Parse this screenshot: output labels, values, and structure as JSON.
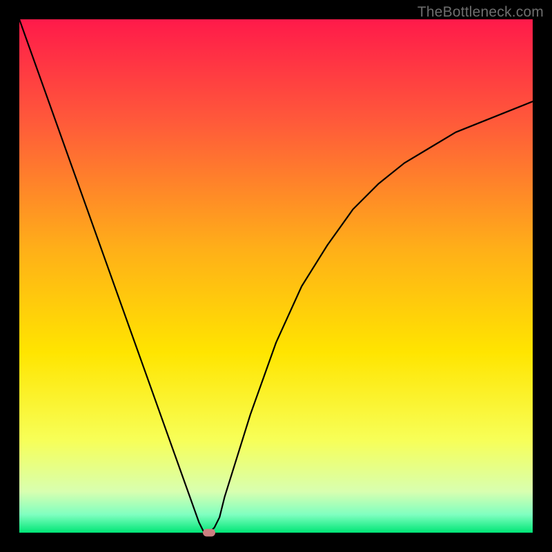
{
  "watermark": "TheBottleneck.com",
  "chart_data": {
    "type": "line",
    "title": "",
    "xlabel": "",
    "ylabel": "",
    "xlim": [
      0,
      100
    ],
    "ylim": [
      0,
      100
    ],
    "x": [
      0,
      5,
      10,
      15,
      20,
      25,
      30,
      35,
      36,
      37,
      38,
      39,
      40,
      45,
      50,
      55,
      60,
      65,
      70,
      75,
      80,
      85,
      90,
      95,
      100
    ],
    "y": [
      100,
      86,
      72,
      58,
      44,
      30,
      16,
      2,
      0,
      0,
      1,
      3,
      7,
      23,
      37,
      48,
      56,
      63,
      68,
      72,
      75,
      78,
      80,
      82,
      84
    ],
    "marker": {
      "x": 37,
      "y": 0
    },
    "background_gradient": {
      "stops": [
        {
          "pos": 0.0,
          "color": "#ff1a4a"
        },
        {
          "pos": 0.2,
          "color": "#ff5a3a"
        },
        {
          "pos": 0.45,
          "color": "#ffb018"
        },
        {
          "pos": 0.65,
          "color": "#ffe500"
        },
        {
          "pos": 0.82,
          "color": "#f7ff58"
        },
        {
          "pos": 0.92,
          "color": "#d8ffb0"
        },
        {
          "pos": 0.965,
          "color": "#7fffc0"
        },
        {
          "pos": 1.0,
          "color": "#00e676"
        }
      ]
    }
  }
}
